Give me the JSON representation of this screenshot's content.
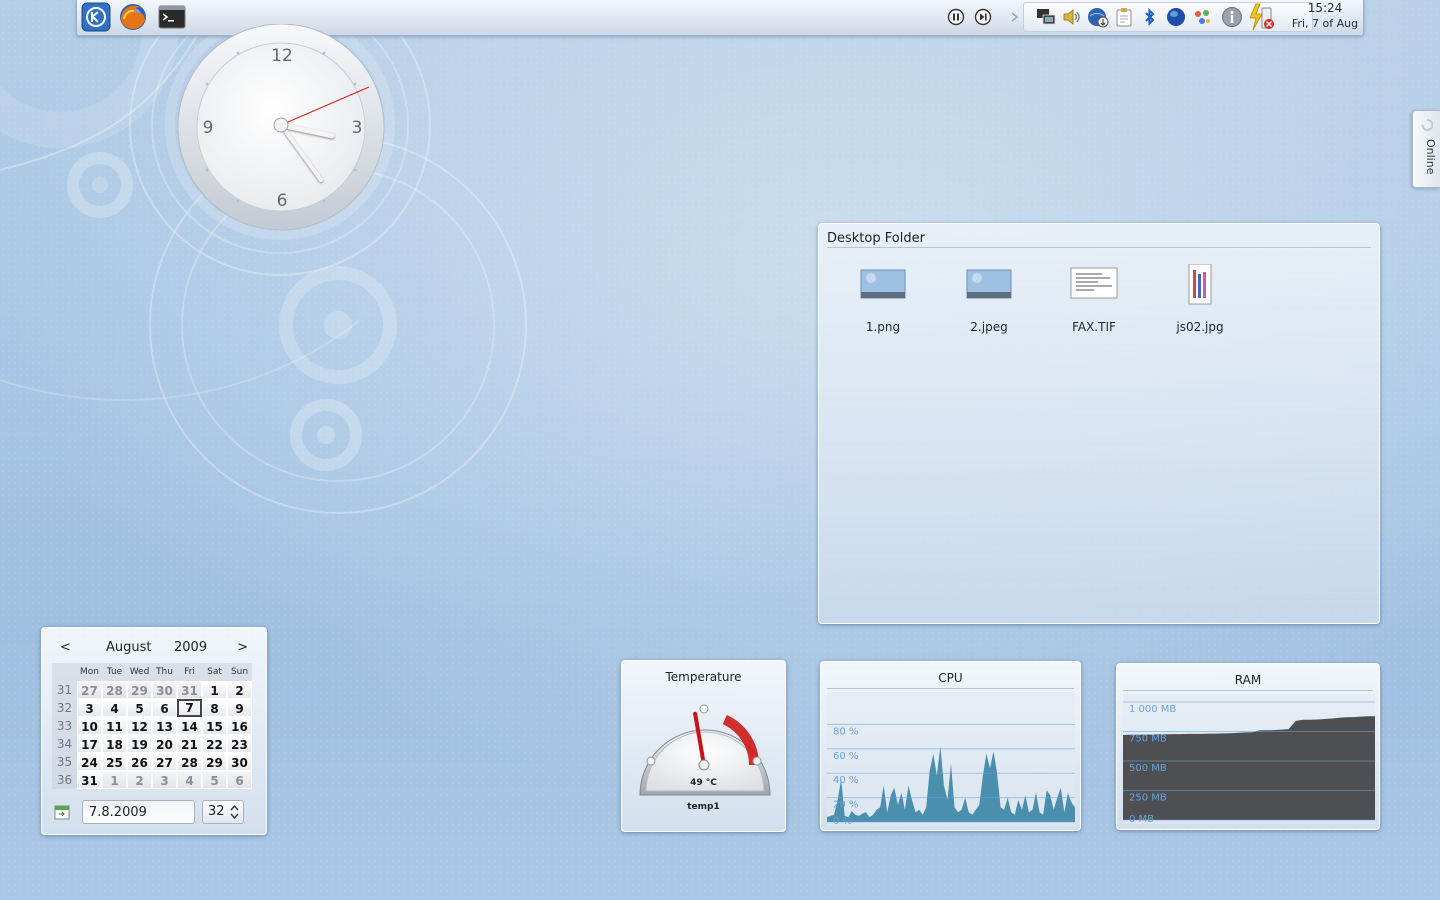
{
  "panel": {
    "launchers": [
      {
        "name": "kde-menu-icon"
      },
      {
        "name": "firefox-icon"
      },
      {
        "name": "terminal-icon"
      }
    ],
    "clock": {
      "time": "15:24",
      "date": "Fri, 7 of Aug"
    }
  },
  "online_tab": {
    "label": "Online"
  },
  "analog_clock": {
    "numerals": [
      "12",
      "3",
      "6",
      "9"
    ],
    "hour": 15,
    "minute": 24
  },
  "folder": {
    "title": "Desktop Folder",
    "files": [
      {
        "name": "1.png"
      },
      {
        "name": "2.jpeg"
      },
      {
        "name": "FAX.TIF"
      },
      {
        "name": "js02.jpg"
      }
    ]
  },
  "calendar": {
    "prev": "<",
    "next": ">",
    "month": "August",
    "year": "2009",
    "weekdays": [
      "Mon",
      "Tue",
      "Wed",
      "Thu",
      "Fri",
      "Sat",
      "Sun"
    ],
    "weeks": [
      {
        "wk": "31",
        "days": [
          "27",
          "28",
          "29",
          "30",
          "31",
          "1",
          "2"
        ],
        "in": [
          0,
          0,
          0,
          0,
          0,
          1,
          1
        ]
      },
      {
        "wk": "32",
        "days": [
          "3",
          "4",
          "5",
          "6",
          "7",
          "8",
          "9"
        ],
        "in": [
          1,
          1,
          1,
          1,
          1,
          1,
          1
        ]
      },
      {
        "wk": "33",
        "days": [
          "10",
          "11",
          "12",
          "13",
          "14",
          "15",
          "16"
        ],
        "in": [
          1,
          1,
          1,
          1,
          1,
          1,
          1
        ]
      },
      {
        "wk": "34",
        "days": [
          "17",
          "18",
          "19",
          "20",
          "21",
          "22",
          "23"
        ],
        "in": [
          1,
          1,
          1,
          1,
          1,
          1,
          1
        ]
      },
      {
        "wk": "35",
        "days": [
          "24",
          "25",
          "26",
          "27",
          "28",
          "29",
          "30"
        ],
        "in": [
          1,
          1,
          1,
          1,
          1,
          1,
          1
        ]
      },
      {
        "wk": "36",
        "days": [
          "31",
          "1",
          "2",
          "3",
          "4",
          "5",
          "6"
        ],
        "in": [
          1,
          0,
          0,
          0,
          0,
          0,
          0
        ]
      }
    ],
    "today": "7",
    "date_value": "7.8.2009",
    "week_value": "32"
  },
  "temperature": {
    "title": "Temperature",
    "value_label": "49 °C",
    "sensor": "temp1",
    "value": 49,
    "min": 0,
    "max": 110
  },
  "cpu": {
    "title": "CPU",
    "labels": [
      "80 %",
      "60 %",
      "40 %",
      "20 %",
      "0 %"
    ]
  },
  "ram": {
    "title": "RAM",
    "labels": [
      "1 000 MB",
      "750 MB",
      "500 MB",
      "250 MB",
      "0 MB"
    ]
  },
  "colors": {
    "accent": "#3d7fa8",
    "cpu_fill": "#4a8fad",
    "ram_fill": "#4d4f52",
    "grid_label": "#6aa2d8",
    "gauge_red": "#d01818"
  },
  "chart_data": [
    {
      "type": "area",
      "title": "CPU",
      "ylim": [
        0,
        100
      ],
      "series": [
        {
          "values": [
            4,
            5,
            6,
            18,
            35,
            5,
            4,
            9,
            6,
            5,
            7,
            8,
            4,
            6,
            10,
            12,
            30,
            8,
            22,
            28,
            14,
            24,
            10,
            30,
            18,
            8,
            10,
            6,
            12,
            42,
            56,
            38,
            62,
            30,
            18,
            48,
            12,
            8,
            10,
            20,
            8,
            6,
            10,
            14,
            38,
            56,
            44,
            58,
            40,
            12,
            10,
            20,
            8,
            6,
            18,
            10,
            22,
            8,
            10,
            24,
            8,
            6,
            26,
            22,
            10,
            20,
            28,
            8,
            24,
            16,
            12
          ]
        }
      ]
    },
    {
      "type": "area",
      "title": "RAM",
      "ylim": [
        0,
        1000
      ],
      "series": [
        {
          "values": [
            720,
            722,
            722,
            724,
            724,
            726,
            726,
            728,
            728,
            730,
            730,
            730,
            732,
            732,
            734,
            736,
            740,
            742,
            744,
            760,
            760,
            762,
            766,
            770,
            840,
            850,
            850,
            852,
            856,
            860,
            866,
            870,
            872,
            876,
            880,
            880
          ]
        }
      ]
    }
  ]
}
